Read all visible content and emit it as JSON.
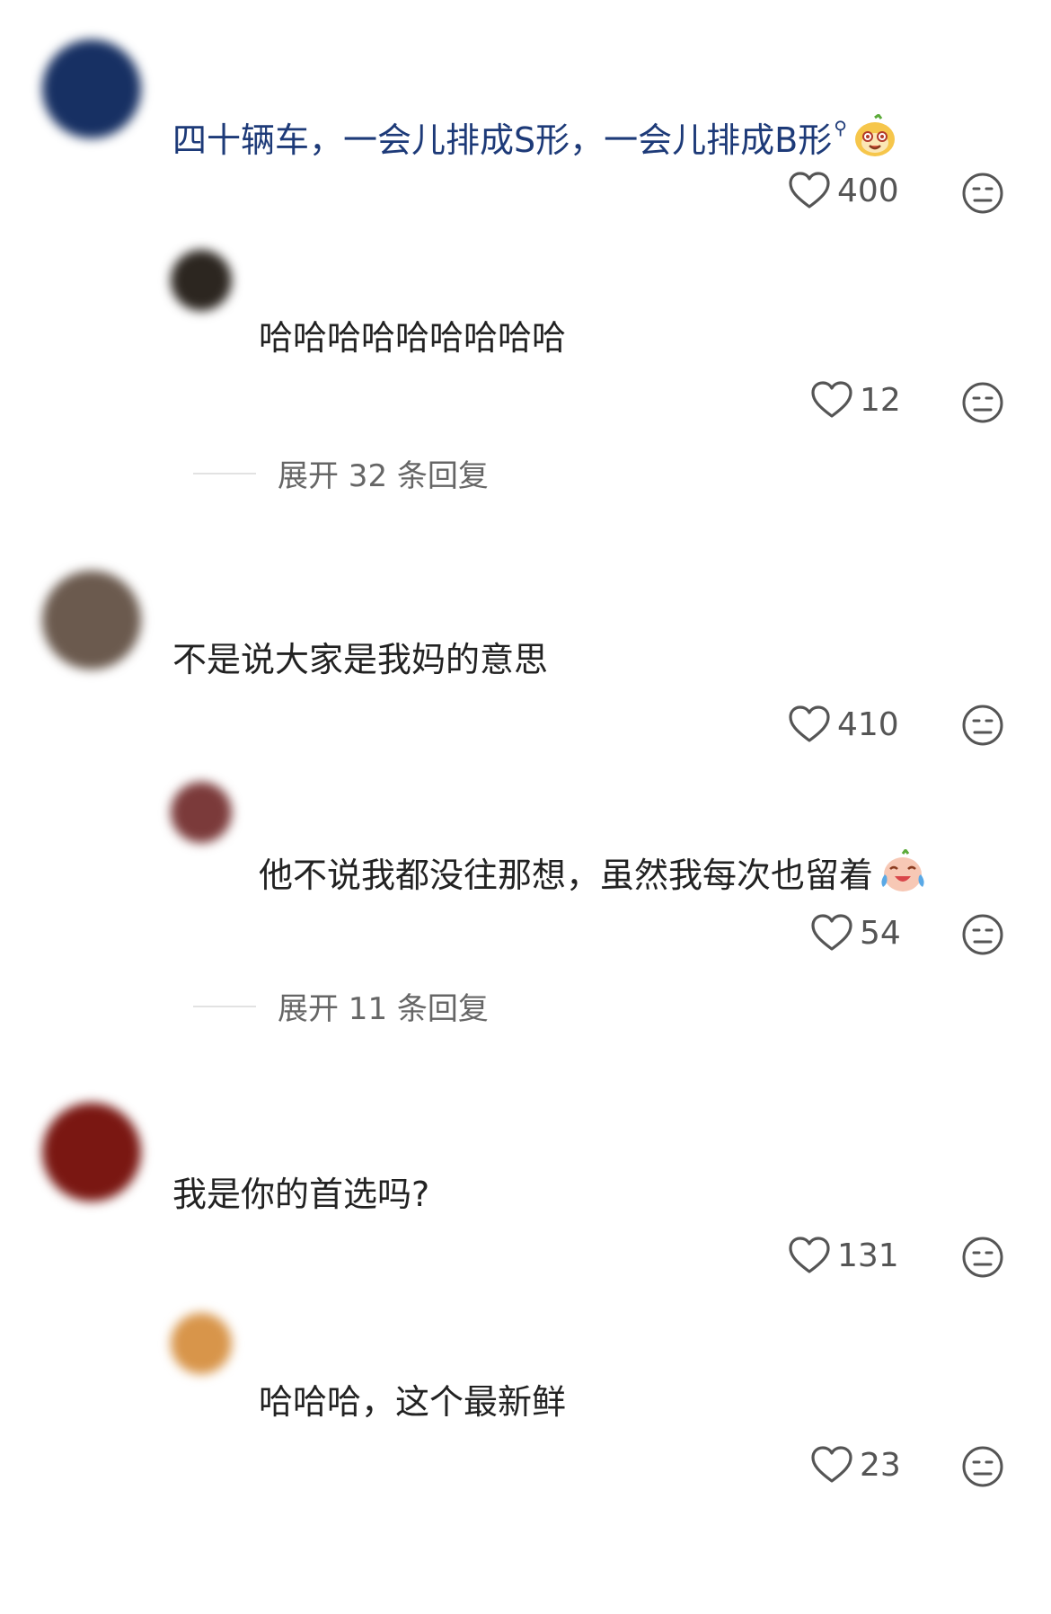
{
  "comments": [
    {
      "text": "四十辆车，一会儿排成S形，一会儿排成B形",
      "search_icon": "magnifier-superscript",
      "emoji": "cartoon-face-emoji",
      "likes": "400",
      "avatar_color": "#173063",
      "reply": {
        "text": "哈哈哈哈哈哈哈哈哈",
        "likes": "12",
        "avatar_color": "#2c2620"
      },
      "expand_label": "展开 32 条回复"
    },
    {
      "text": "不是说大家是我妈的意思",
      "likes": "410",
      "avatar_color": "#6b5a4e",
      "reply": {
        "text": "他不说我都没往那想，虽然我每次也留着",
        "emoji": "crying-laughing-emoji",
        "likes": "54",
        "avatar_color": "#7b3a3a"
      },
      "expand_label": "展开 11 条回复"
    },
    {
      "text": "我是你的首选吗?",
      "likes": "131",
      "avatar_color": "#7a1712",
      "reply": {
        "text": "哈哈哈，这个最新鲜",
        "likes": "23",
        "avatar_color": "#d8954a"
      }
    }
  ],
  "colors": {
    "text": "#222222",
    "highlight_text": "#1d3a78",
    "meta": "#555555"
  }
}
